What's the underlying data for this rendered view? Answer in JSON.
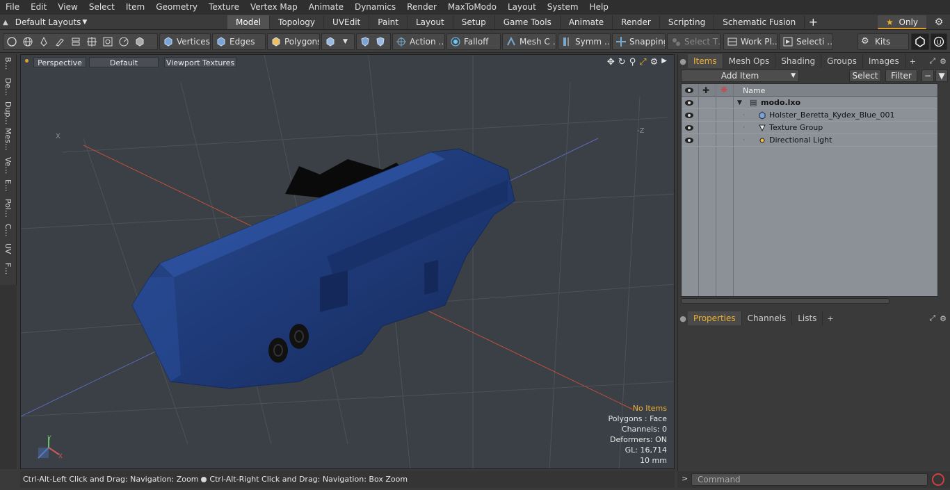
{
  "menu": [
    "File",
    "Edit",
    "View",
    "Select",
    "Item",
    "Geometry",
    "Texture",
    "Vertex Map",
    "Animate",
    "Dynamics",
    "Render",
    "MaxToModo",
    "Layout",
    "System",
    "Help"
  ],
  "layouts": {
    "label": "Default Layouts"
  },
  "tabs": [
    "Model",
    "Topology",
    "UVEdit",
    "Paint",
    "Layout",
    "Setup",
    "Game Tools",
    "Animate",
    "Render",
    "Scripting",
    "Schematic Fusion"
  ],
  "tabs_active": "Model",
  "only_label": "Only",
  "toolbar": {
    "vertices": "Vertices",
    "edges": "Edges",
    "polygons": "Polygons",
    "action": "Action …",
    "falloff": "Falloff",
    "mesh": "Mesh C …",
    "symm": "Symm …",
    "snapping": "Snapping",
    "select_t": "Select T…",
    "work_pl": "Work Pl…",
    "selecti": "Selecti …",
    "kits": "Kits"
  },
  "left_tabs": [
    "B…",
    "De…",
    "Dup…",
    "Mes…",
    "Ve…",
    "E…",
    "Pol…",
    "C…",
    "UV",
    "F…"
  ],
  "viewport": {
    "view": "Perspective",
    "shading": "Default",
    "textures": "Viewport Textures",
    "axis_x": "X",
    "axis_z": "-Z",
    "info": {
      "no_items": "No Items",
      "polygons": "Polygons : Face",
      "channels": "Channels: 0",
      "deformers": "Deformers: ON",
      "gl": "GL: 16,714",
      "scale": "10 mm"
    }
  },
  "status": {
    "left": "Ctrl-Alt-Left Click and Drag: Navigation: Zoom",
    "right": "Ctrl-Alt-Right Click and Drag: Navigation: Box Zoom"
  },
  "items_panel": {
    "tabs": [
      "Items",
      "Mesh Ops",
      "Shading",
      "Groups",
      "Images"
    ],
    "active": "Items",
    "add_item": "Add Item",
    "select": "Select",
    "filter": "Filter",
    "col_name": "Name",
    "rows": [
      {
        "name": "modo.lxo",
        "icon": "scene-icon"
      },
      {
        "name": "Holster_Beretta_Kydex_Blue_001",
        "icon": "mesh-icon"
      },
      {
        "name": "Texture Group",
        "icon": "texture-icon"
      },
      {
        "name": "Directional Light",
        "icon": "light-icon"
      }
    ]
  },
  "props_panel": {
    "tabs": [
      "Properties",
      "Channels",
      "Lists"
    ],
    "active": "Properties"
  },
  "command": {
    "placeholder": "Command"
  },
  "colors": {
    "accent": "#f0b030",
    "viewport_bg": "#3b4046",
    "holster": "#1f3a78"
  }
}
